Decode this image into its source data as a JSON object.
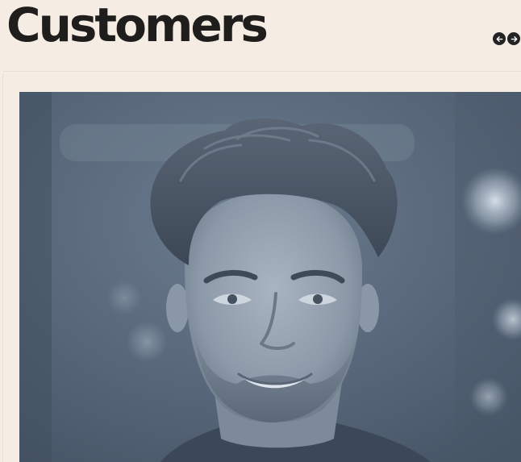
{
  "page": {
    "title": "Customers"
  },
  "carousel": {
    "prev_icon": "arrow-left-icon",
    "next_icon": "arrow-right-icon"
  },
  "colors": {
    "background": "#f5ece3",
    "title_text": "#1f1e1d",
    "nav_button": "#232323",
    "photo_tint": "#5e6f82"
  }
}
